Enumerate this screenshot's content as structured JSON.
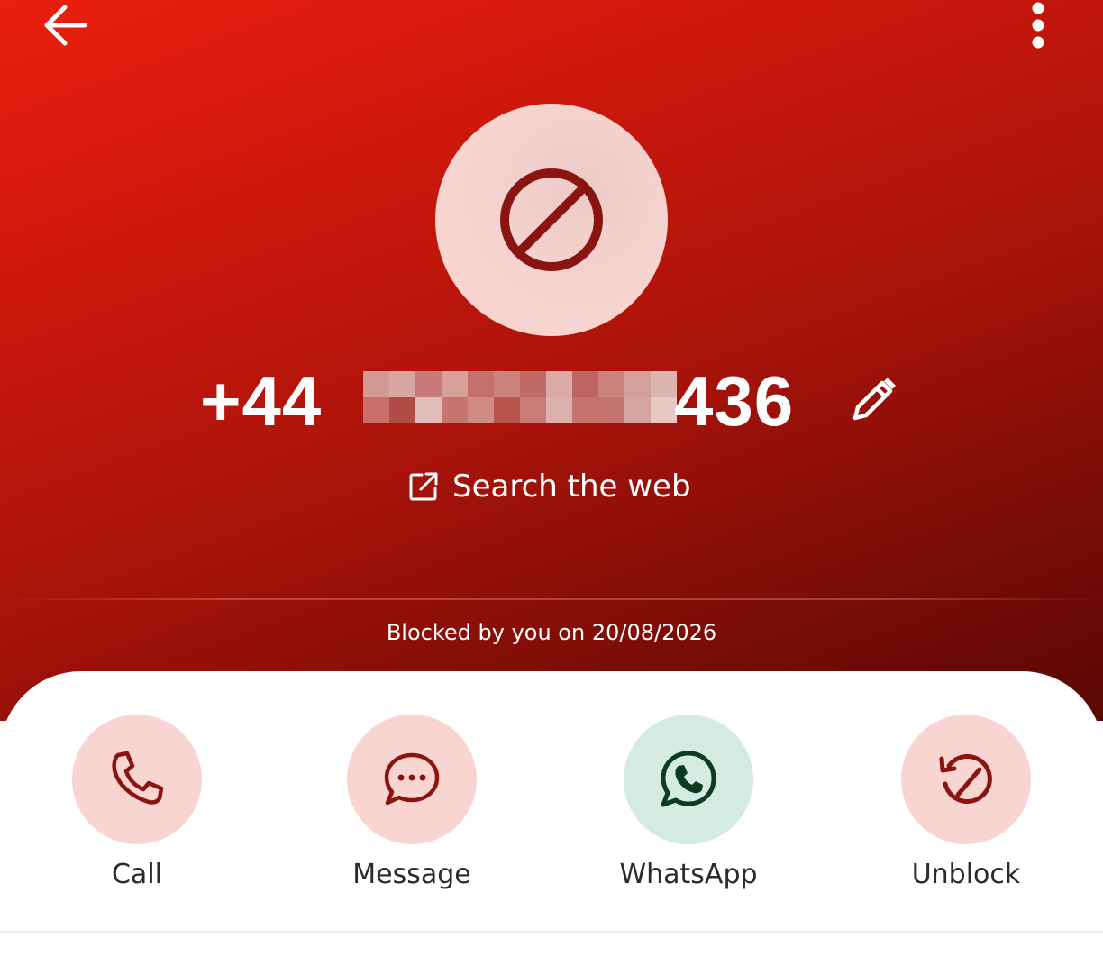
{
  "colors": {
    "hero_start": "#ea1f0d",
    "hero_end": "#5a0703",
    "accent_dark": "#8a1410",
    "action_bg": "#f8d5d1",
    "whatsapp_bg": "#d3ebe0",
    "whatsapp_icon": "#0c3b22",
    "label_text": "#2b2b2b"
  },
  "topbar": {
    "back_icon": "arrow-left-icon",
    "menu_icon": "more-vertical-icon"
  },
  "avatar": {
    "icon": "block-icon"
  },
  "contact": {
    "number_prefix": "+44",
    "number_suffix": "436",
    "edit_icon": "pencil-icon"
  },
  "search_web": {
    "icon": "open-external-icon",
    "label": "Search the web"
  },
  "blocked_info": "Blocked by you on 20/08/2026",
  "actions": [
    {
      "label": "Call",
      "icon": "phone-icon"
    },
    {
      "label": "Message",
      "icon": "chat-icon"
    },
    {
      "label": "WhatsApp",
      "icon": "whatsapp-icon"
    },
    {
      "label": "Unblock",
      "icon": "unblock-icon"
    }
  ]
}
